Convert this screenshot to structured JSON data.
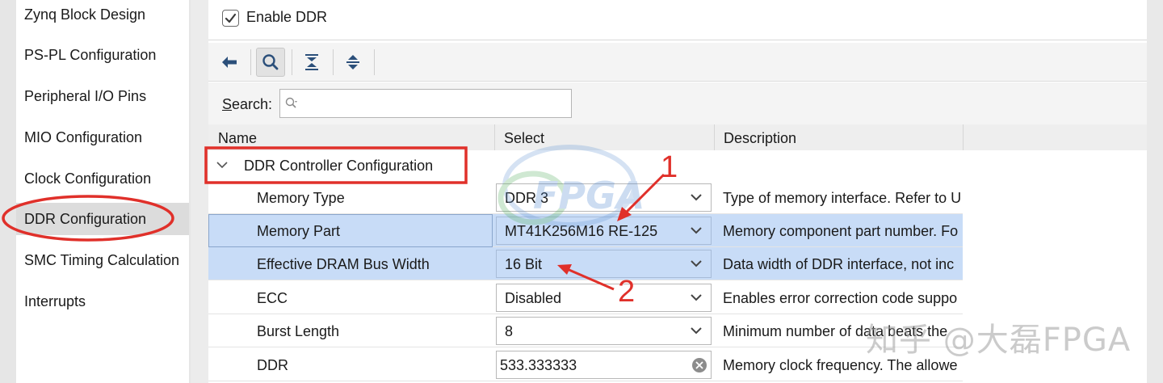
{
  "sidebar": {
    "items": [
      {
        "label": "Zynq Block Design"
      },
      {
        "label": "PS-PL Configuration"
      },
      {
        "label": "Peripheral I/O Pins"
      },
      {
        "label": "MIO Configuration"
      },
      {
        "label": "Clock Configuration"
      },
      {
        "label": "DDR Configuration",
        "selected": true
      },
      {
        "label": "SMC Timing Calculation"
      },
      {
        "label": "Interrupts"
      }
    ]
  },
  "enable_ddr": {
    "label": "Enable DDR",
    "checked": true
  },
  "toolbar": {
    "icons": [
      "back-arrow-icon",
      "search-icon",
      "collapse-all-icon",
      "expand-all-icon"
    ]
  },
  "search": {
    "label": "Search:",
    "value": ""
  },
  "table": {
    "columns": [
      "Name",
      "Select",
      "Description"
    ],
    "group": {
      "label": "DDR Controller Configuration",
      "expanded": true
    },
    "rows": [
      {
        "name": "Memory Type",
        "value": "DDR 3",
        "description": "Type of memory interface. Refer to U",
        "type": "dropdown"
      },
      {
        "name": "Memory Part",
        "value": "MT41K256M16 RE-125",
        "description": "Memory component part number. Fo",
        "type": "dropdown",
        "selected": true
      },
      {
        "name": "Effective DRAM Bus Width",
        "value": "16 Bit",
        "description": "Data width of DDR interface, not inc",
        "type": "dropdown",
        "selected": true
      },
      {
        "name": "ECC",
        "value": "Disabled",
        "description": "Enables error correction code suppo",
        "type": "dropdown"
      },
      {
        "name": "Burst Length",
        "value": "8",
        "description": "Minimum number of data beats the",
        "type": "dropdown"
      },
      {
        "name": "DDR",
        "value": "533.333333",
        "description": "Memory clock frequency. The allowe",
        "type": "textbox"
      }
    ]
  },
  "annotations": {
    "label_1": "1",
    "label_2": "2",
    "accent_color": "#e0302a"
  },
  "watermark": {
    "text": "知乎 @大磊FPGA",
    "logo_text": "FPGA"
  }
}
